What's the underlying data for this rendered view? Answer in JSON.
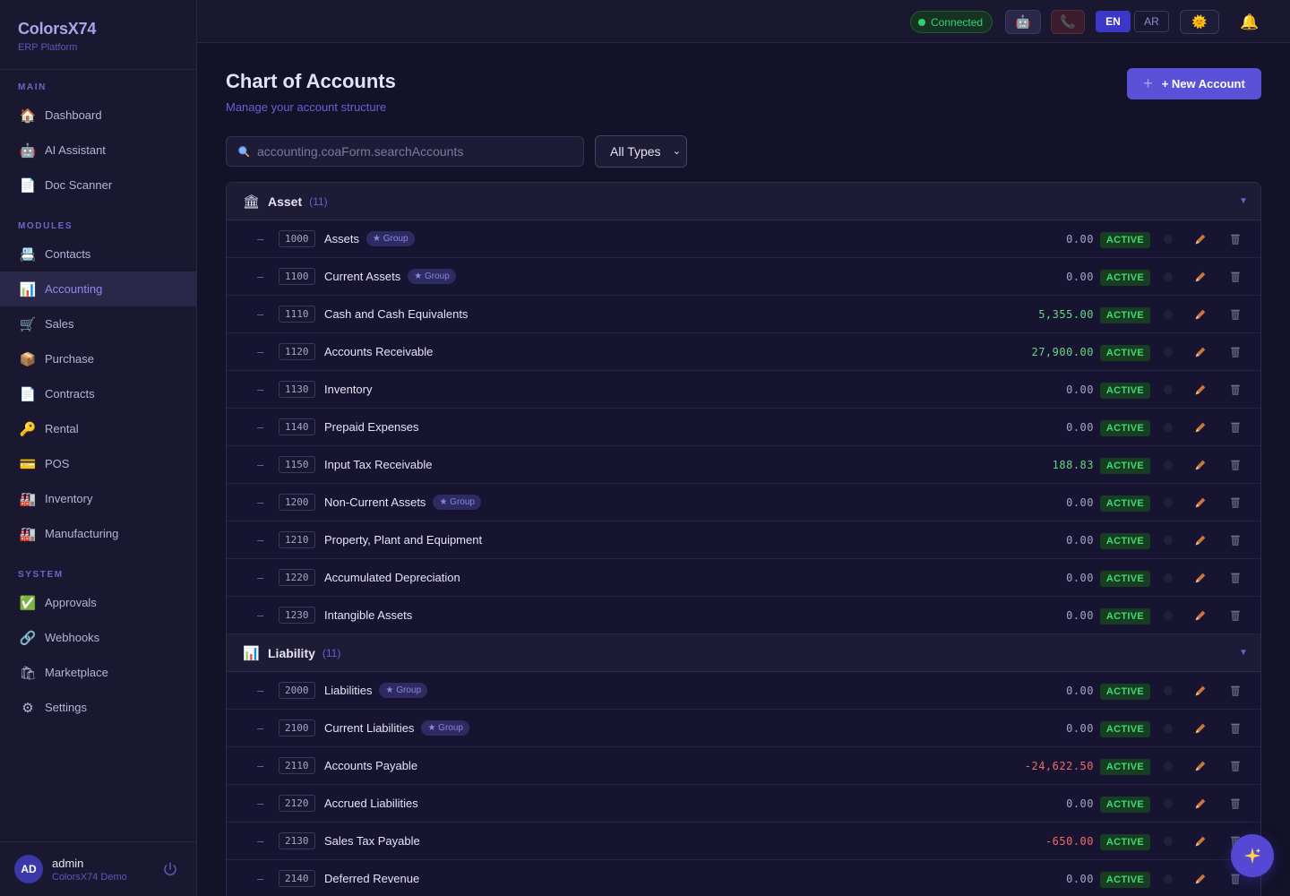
{
  "app": {
    "title": "ColorsX74",
    "subtitle": "ERP Platform"
  },
  "sidebar": {
    "sections": {
      "main": "MAIN",
      "modules": "MODULES",
      "system": "SYSTEM"
    },
    "items": [
      {
        "label": "Dashboard",
        "icon": "🏠"
      },
      {
        "label": "AI Assistant",
        "icon": "🤖"
      },
      {
        "label": "Doc Scanner",
        "icon": "📄"
      },
      {
        "label": "Contacts",
        "icon": "📇"
      },
      {
        "label": "Accounting",
        "icon": "📊"
      },
      {
        "label": "Sales",
        "icon": "🛒"
      },
      {
        "label": "Purchase",
        "icon": "📦"
      },
      {
        "label": "Contracts",
        "icon": "📄"
      },
      {
        "label": "Rental",
        "icon": "🔑"
      },
      {
        "label": "POS",
        "icon": "💳"
      },
      {
        "label": "Inventory",
        "icon": "🏭"
      },
      {
        "label": "Manufacturing",
        "icon": "🏭"
      },
      {
        "label": "Approvals",
        "icon": "✅"
      },
      {
        "label": "Webhooks",
        "icon": "🔗"
      },
      {
        "label": "Marketplace",
        "icon": "🛍"
      },
      {
        "label": "Settings",
        "icon": "⚙"
      }
    ],
    "active": "Accounting",
    "user": {
      "initials": "AD",
      "name": "admin",
      "org": "ColorsX74 Demo"
    }
  },
  "topbar": {
    "status": "Connected",
    "lang_en": "EN",
    "lang_ar": "AR",
    "robot_icon": "🤖",
    "phone_icon": "📞",
    "theme_icon": "🌞",
    "bell_icon": "🔔"
  },
  "page": {
    "title": "Chart of Accounts",
    "subtitle": "Manage your account structure",
    "new_button": "+ New Account",
    "search_placeholder": "accounting.coaForm.searchAccounts",
    "type_filter": "All Types"
  },
  "groups": [
    {
      "name": "Asset",
      "count": "(11)",
      "icon": "🏛",
      "rows": [
        {
          "code": "1000",
          "name": "Assets",
          "group": "★ Group",
          "amount": "0.00",
          "status": "ACTIVE"
        },
        {
          "code": "1100",
          "name": "Current Assets",
          "group": "★ Group",
          "amount": "0.00",
          "status": "ACTIVE"
        },
        {
          "code": "1110",
          "name": "Cash and Cash Equivalents",
          "group": "",
          "amount": "5,355.00",
          "status": "ACTIVE"
        },
        {
          "code": "1120",
          "name": "Accounts Receivable",
          "group": "",
          "amount": "27,900.00",
          "status": "ACTIVE"
        },
        {
          "code": "1130",
          "name": "Inventory",
          "group": "",
          "amount": "0.00",
          "status": "ACTIVE"
        },
        {
          "code": "1140",
          "name": "Prepaid Expenses",
          "group": "",
          "amount": "0.00",
          "status": "ACTIVE"
        },
        {
          "code": "1150",
          "name": "Input Tax Receivable",
          "group": "",
          "amount": "188.83",
          "status": "ACTIVE"
        },
        {
          "code": "1200",
          "name": "Non-Current Assets",
          "group": "★ Group",
          "amount": "0.00",
          "status": "ACTIVE"
        },
        {
          "code": "1210",
          "name": "Property, Plant and Equipment",
          "group": "",
          "amount": "0.00",
          "status": "ACTIVE"
        },
        {
          "code": "1220",
          "name": "Accumulated Depreciation",
          "group": "",
          "amount": "0.00",
          "status": "ACTIVE"
        },
        {
          "code": "1230",
          "name": "Intangible Assets",
          "group": "",
          "amount": "0.00",
          "status": "ACTIVE"
        }
      ]
    },
    {
      "name": "Liability",
      "count": "(11)",
      "icon": "📊",
      "rows": [
        {
          "code": "2000",
          "name": "Liabilities",
          "group": "★ Group",
          "amount": "0.00",
          "status": "ACTIVE"
        },
        {
          "code": "2100",
          "name": "Current Liabilities",
          "group": "★ Group",
          "amount": "0.00",
          "status": "ACTIVE"
        },
        {
          "code": "2110",
          "name": "Accounts Payable",
          "group": "",
          "amount": "-24,622.50",
          "status": "ACTIVE"
        },
        {
          "code": "2120",
          "name": "Accrued Liabilities",
          "group": "",
          "amount": "0.00",
          "status": "ACTIVE"
        },
        {
          "code": "2130",
          "name": "Sales Tax Payable",
          "group": "",
          "amount": "-650.00",
          "status": "ACTIVE"
        },
        {
          "code": "2140",
          "name": "Deferred Revenue",
          "group": "",
          "amount": "0.00",
          "status": "ACTIVE"
        }
      ]
    }
  ],
  "colors": {
    "accent": "#5b50d8",
    "active_badge": "#3ddc6f",
    "negative": "#f06a6a",
    "positive": "#66d982"
  }
}
